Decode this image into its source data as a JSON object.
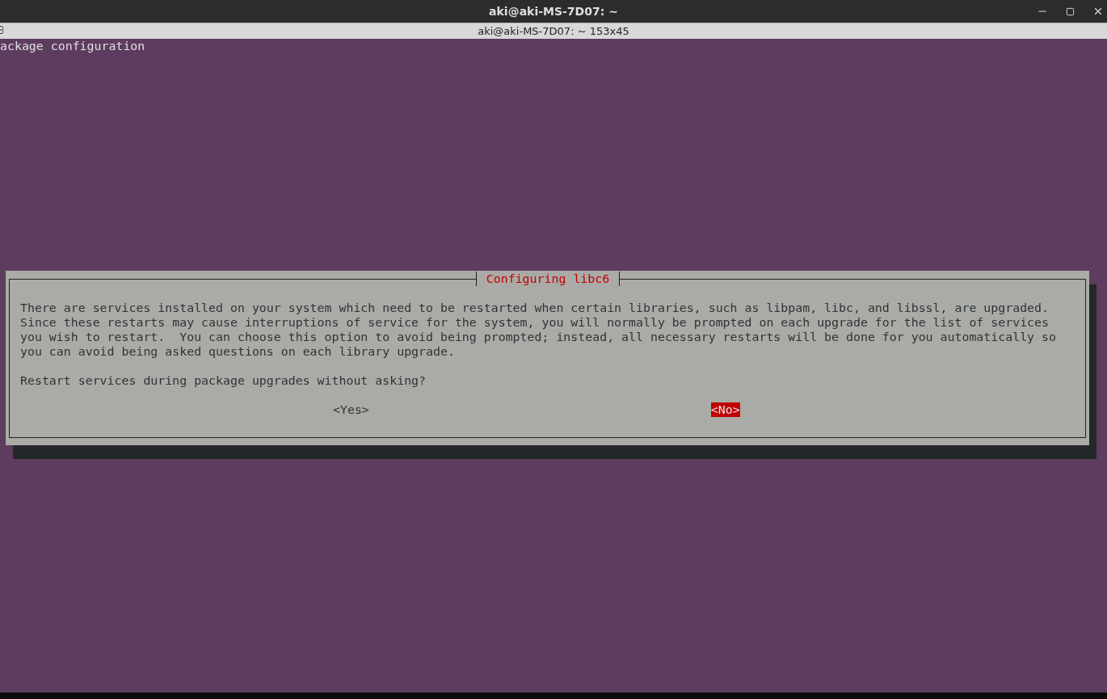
{
  "window": {
    "title": "aki@aki-MS-7D07: ~"
  },
  "tab": {
    "title": "aki@aki-MS-7D07: ~ 153x45"
  },
  "terminal": {
    "lines": [
      "ackage configuration"
    ]
  },
  "dialog": {
    "title": "Configuring libc6",
    "message": "There are services installed on your system which need to be restarted when certain libraries, such as libpam, libc, and libssl, are upgraded.\nSince these restarts may cause interruptions of service for the system, you will normally be prompted on each upgrade for the list of services\nyou wish to restart.  You can choose this option to avoid being prompted; instead, all necessary restarts will be done for you automatically so\nyou can avoid being asked questions on each library upgrade.",
    "question": "Restart services during package upgrades without asking?",
    "buttons": [
      {
        "label": "<Yes>",
        "selected": false
      },
      {
        "label": "<No>",
        "selected": true
      }
    ]
  }
}
